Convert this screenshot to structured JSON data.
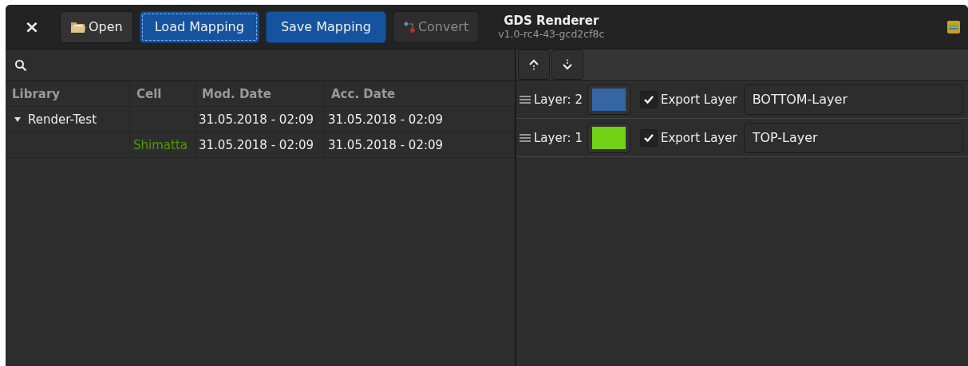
{
  "header": {
    "close": "×",
    "buttons": [
      {
        "label": "Open",
        "kind": "open",
        "disabled": false,
        "focused": false,
        "suggested": false
      },
      {
        "label": "Load Mapping",
        "kind": "plain",
        "disabled": false,
        "focused": true,
        "suggested": true
      },
      {
        "label": "Save Mapping",
        "kind": "plain",
        "disabled": false,
        "focused": false,
        "suggested": true
      },
      {
        "label": "Convert",
        "kind": "convert",
        "disabled": true,
        "focused": false,
        "suggested": false
      }
    ],
    "title": "GDS Renderer",
    "subtitle": "v1.0-rc4-43-gcd2cf8c"
  },
  "table": {
    "columns": [
      "Library",
      "Cell",
      "Mod. Date",
      "Acc. Date"
    ],
    "rows": [
      {
        "library": "Render-Test",
        "mod": "31.05.2018 - 02:09",
        "acc": "31.05.2018 - 02:09",
        "expanded": true,
        "children": [
          {
            "cell": "Shimatta",
            "mod": "31.05.2018 - 02:09",
            "acc": "31.05.2018 - 02:09"
          }
        ]
      }
    ]
  },
  "layers": [
    {
      "label": "Layer: 2",
      "color": "#3465a4",
      "export": "Export Layer",
      "checked": true,
      "name": "BOTTOM-Layer"
    },
    {
      "label": "Layer: 1",
      "color": "#73d216",
      "export": "Export Layer",
      "checked": true,
      "name": "TOP-Layer"
    }
  ]
}
